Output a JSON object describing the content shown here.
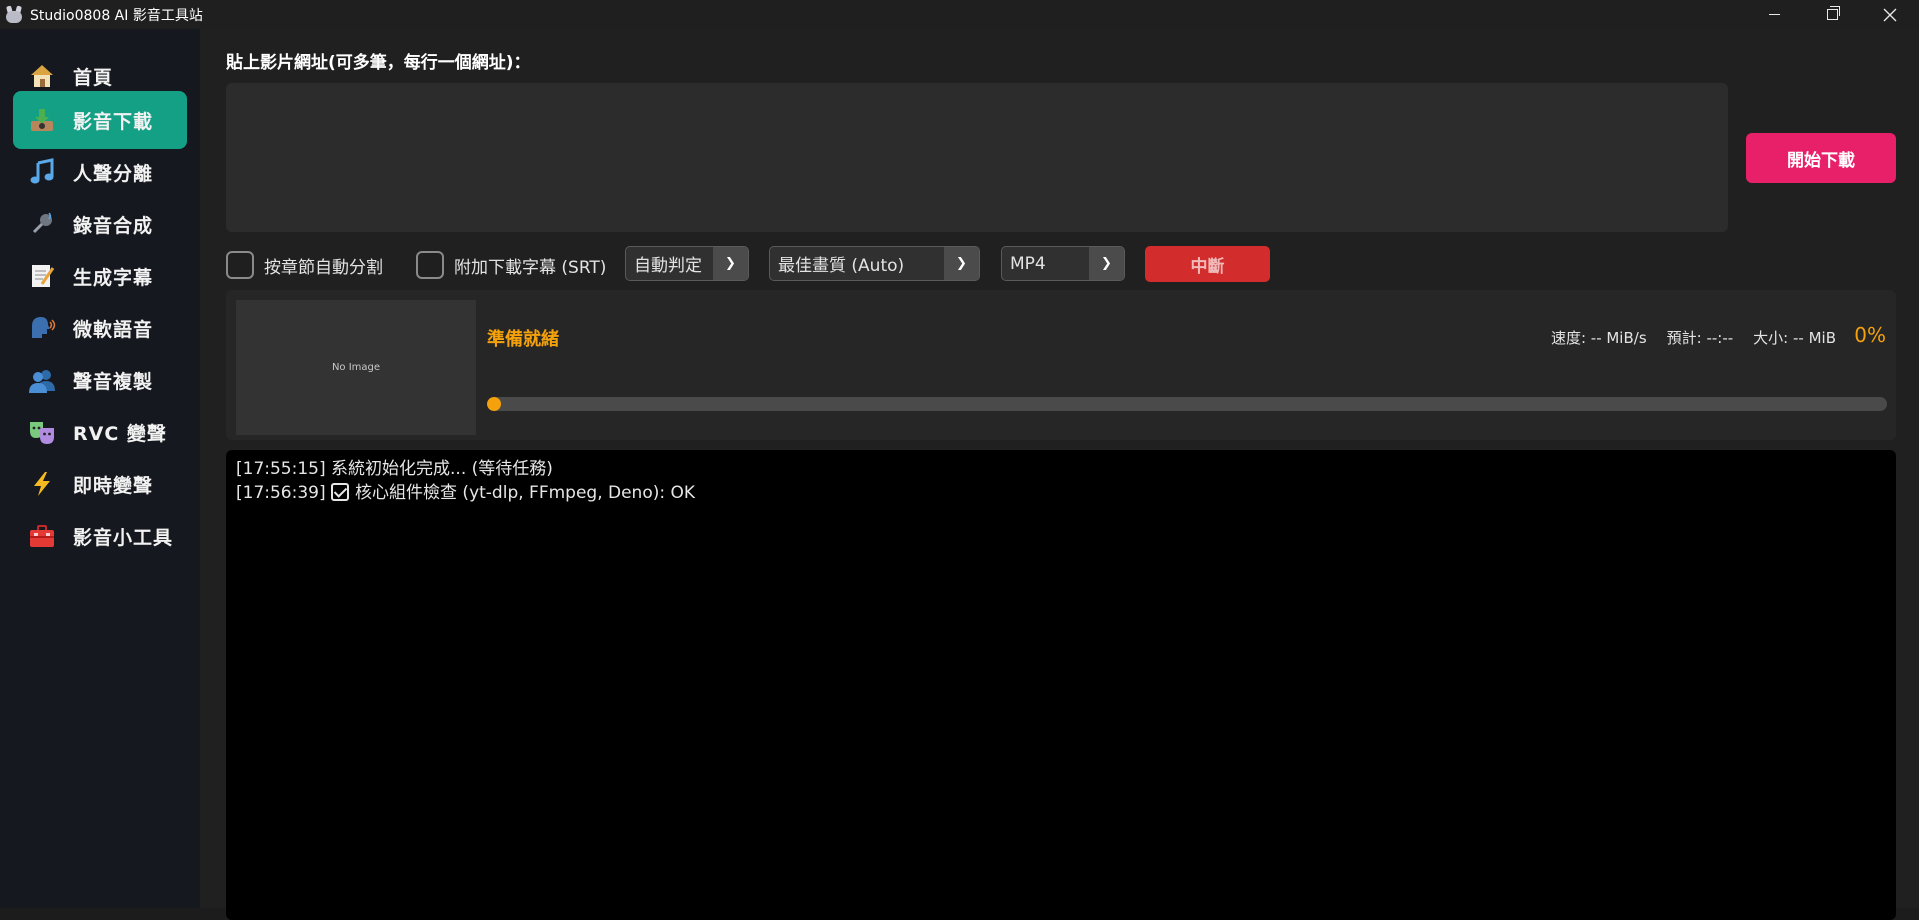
{
  "window": {
    "title": "Studio0808 AI 影音工具站"
  },
  "sidebar": {
    "items": [
      {
        "label": "首頁",
        "icon": "house-icon",
        "active": false
      },
      {
        "label": "影音下載",
        "icon": "download-tray-icon",
        "active": true
      },
      {
        "label": "人聲分離",
        "icon": "music-note-icon",
        "active": false
      },
      {
        "label": "錄音合成",
        "icon": "microphone-icon",
        "active": false
      },
      {
        "label": "生成字幕",
        "icon": "memo-icon",
        "active": false
      },
      {
        "label": "微軟語音",
        "icon": "speaking-head-icon",
        "active": false
      },
      {
        "label": "聲音複製",
        "icon": "busts-icon",
        "active": false
      },
      {
        "label": "RVC 變聲",
        "icon": "theater-masks-icon",
        "active": false
      },
      {
        "label": "即時變聲",
        "icon": "lightning-icon",
        "active": false
      },
      {
        "label": "影音小工具",
        "icon": "toolbox-icon",
        "active": false
      }
    ],
    "accent": "#13a085"
  },
  "download": {
    "url_label": "貼上影片網址(可多筆，每行一個網址)：",
    "url_value": "",
    "start_label": "開始下載",
    "chapter_split_label": "按章節自動分割",
    "chapter_split_checked": false,
    "subtitle_label": "附加下載字幕 (SRT)",
    "subtitle_checked": false,
    "subtitle_lang": "自動判定",
    "quality": "最佳畫質 (Auto)",
    "format": "MP4",
    "stop_label": "中斷"
  },
  "status": {
    "thumbnail_text": "No Image",
    "state": "準備就緒",
    "speed": "速度: -- MiB/s",
    "eta": "預計: --:--",
    "size": "大小: -- MiB",
    "percent_text": "0%",
    "progress": 0
  },
  "log": [
    {
      "time": "[17:55:15]",
      "text": "系統初始化完成... (等待任務)",
      "icon": null
    },
    {
      "time": "[17:56:39]",
      "text": "核心組件檢查 (yt-dlp, FFmpeg, Deno): OK",
      "icon": "check-box-icon"
    }
  ],
  "colors": {
    "start_button": "#e8206a",
    "stop_button": "#d32c2c",
    "status_orange": "#f4a10c"
  }
}
